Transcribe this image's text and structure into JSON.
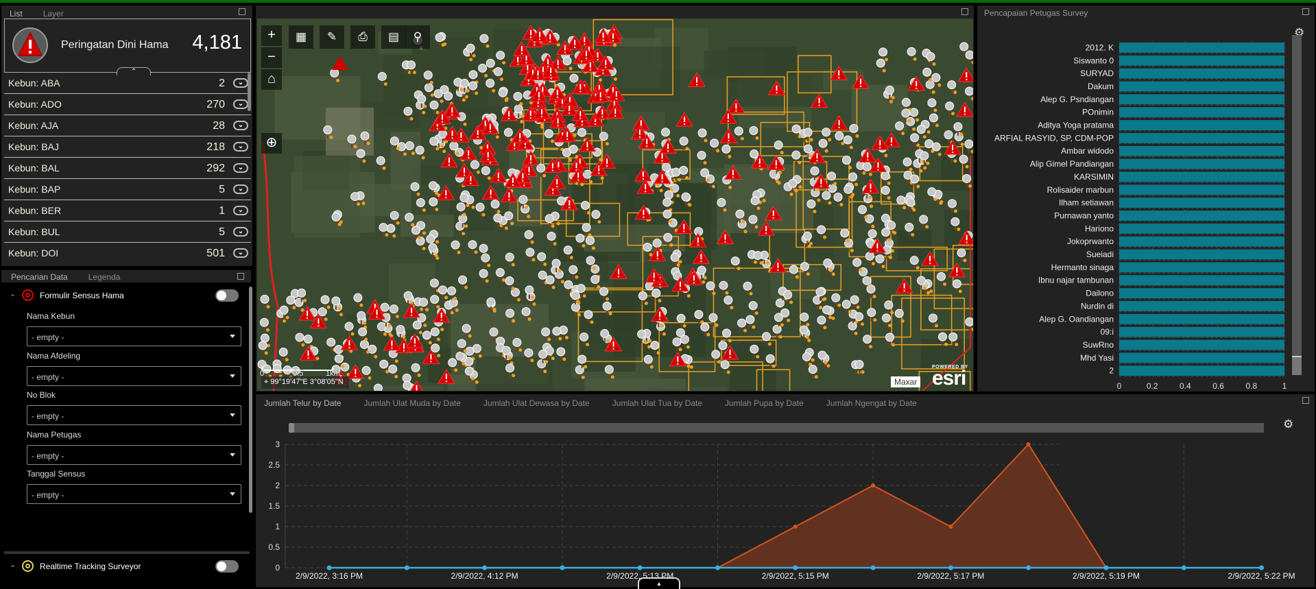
{
  "list_panel": {
    "tabs": [
      {
        "label": "List",
        "active": true
      },
      {
        "label": "Layer",
        "active": false
      }
    ],
    "summary": {
      "icon": "warning-icon",
      "title": "Peringatan Dini Hama",
      "count": "4,181"
    },
    "rows": [
      {
        "label": "Kebun: ABA",
        "value": "2"
      },
      {
        "label": "Kebun: ADO",
        "value": "270"
      },
      {
        "label": "Kebun: AJA",
        "value": "28"
      },
      {
        "label": "Kebun: BAJ",
        "value": "218"
      },
      {
        "label": "Kebun: BAL",
        "value": "292"
      },
      {
        "label": "Kebun: BAP",
        "value": "5"
      },
      {
        "label": "Kebun: BER",
        "value": "1"
      },
      {
        "label": "Kebun: BUL",
        "value": "5"
      },
      {
        "label": "Kebun: DOI",
        "value": "501"
      }
    ]
  },
  "filter_panel": {
    "tabs": [
      {
        "label": "Pencarian Data",
        "active": true
      },
      {
        "label": "Legenda",
        "active": false
      }
    ],
    "groups": [
      {
        "title": "Formulir Sensus Hama",
        "icon": "target-icon",
        "icon_color": "#e00000",
        "enabled": false,
        "fields": [
          {
            "label": "Nama Kebun",
            "value": "- empty -"
          },
          {
            "label": "Nama Afdeling",
            "value": "- empty -"
          },
          {
            "label": "No Blok",
            "value": "- empty -"
          },
          {
            "label": "Nama Petugas",
            "value": "- empty -"
          },
          {
            "label": "Tanggal Sensus",
            "value": "- empty -"
          }
        ]
      },
      {
        "title": "Realtime Tracking Surveyor",
        "icon": "target-icon",
        "icon_color": "#e0d060",
        "enabled": false
      }
    ]
  },
  "map": {
    "tools": [
      "zoom-in",
      "zoom-out",
      "home",
      "locate",
      "basemap-gallery",
      "measure",
      "print",
      "bookmark",
      "search"
    ],
    "zoom_in": "+",
    "zoom_out": "−",
    "scale_labels": [
      "0",
      "0.5",
      "1km"
    ],
    "coordinates": "99°19'47\"E 3°08'05\"N",
    "attribution": "Maxar",
    "powered_by": "POWERED BY",
    "esri_logo": "esri",
    "colors": {
      "warning_marker": "#d40000",
      "survey_marker": "#c8c8c8",
      "boundary": "#e8a020",
      "region_border": "#e02020"
    }
  },
  "bar_panel": {
    "title": "Pencapaian Petugas Survey",
    "chart_data": {
      "type": "bar",
      "orientation": "horizontal",
      "title": "Pencapaian Petugas Survey",
      "categories": [
        "2012. K",
        "Siswanto 0",
        "SURYAD",
        "Dakum",
        "Alep G. Psndiangan",
        "POnimin",
        "Aditya Yoga pratama",
        "ARFIAL RASYID, SP, CDM-POP",
        "Ambar widodo",
        "Alip Gimel Pandiangan",
        "KARSIMIN",
        "Rolisaider marbun",
        "Ilham setiawan",
        "Purnawan yanto",
        "Hariono",
        "Jokoprwanto",
        "Sueiadi",
        "Hermanto sinaga",
        "Ibnu najar tambunan",
        "Dailono",
        "Nurdin di",
        "Alep G. Oandiangan",
        "09:i",
        "SuwRno",
        "Mhd Yasi",
        "2"
      ],
      "values": [
        1,
        1,
        1,
        1,
        1,
        1,
        1,
        1,
        1,
        1,
        1,
        1,
        1,
        1,
        1,
        1,
        1,
        1,
        1,
        1,
        1,
        1,
        1,
        1,
        1,
        1
      ],
      "xlim": [
        0,
        1
      ],
      "xticks": [
        "0",
        "0.2",
        "0.4",
        "0.6",
        "0.8",
        "1"
      ],
      "bar_color": "#0a7a8c",
      "grid": true
    }
  },
  "line_panel": {
    "tabs": [
      {
        "label": "Jumlah Telur by Date",
        "active": true
      },
      {
        "label": "Jumlah Ulat Muda by Date",
        "active": false
      },
      {
        "label": "Jumlah Ulat Dewasa by Date",
        "active": false
      },
      {
        "label": "Jumlah Ulat Tua by Date",
        "active": false
      },
      {
        "label": "Jumlah Pupa by Date",
        "active": false
      },
      {
        "label": "Jumlah Ngengat by Date",
        "active": false
      }
    ],
    "chart_data": {
      "type": "area",
      "title": "Jumlah Telur by Date",
      "ylim": [
        0,
        3
      ],
      "yticks": [
        "0",
        "0.5",
        "1",
        "1.5",
        "2",
        "2.5",
        "3"
      ],
      "x_tick_labels": [
        "2/9/2022, 3:16 PM",
        "2/9/2022, 4:12 PM",
        "2/9/2022, 5:13 PM",
        "2/9/2022, 5:15 PM",
        "2/9/2022, 5:17 PM",
        "2/9/2022, 5:19 PM",
        "2/9/2022, 5:22 PM"
      ],
      "point_count": 13,
      "series": [
        {
          "name": "orange",
          "color": "#d0561c",
          "fill": "#63311f",
          "values": [
            0,
            0,
            0,
            0,
            0,
            0,
            1,
            2,
            1,
            3,
            0,
            0,
            0
          ]
        },
        {
          "name": "blue",
          "color": "#3ab0e0",
          "values": [
            0,
            0,
            0,
            0,
            0,
            0,
            0,
            0,
            0,
            0,
            0,
            0,
            0
          ]
        }
      ],
      "grid": true
    }
  }
}
